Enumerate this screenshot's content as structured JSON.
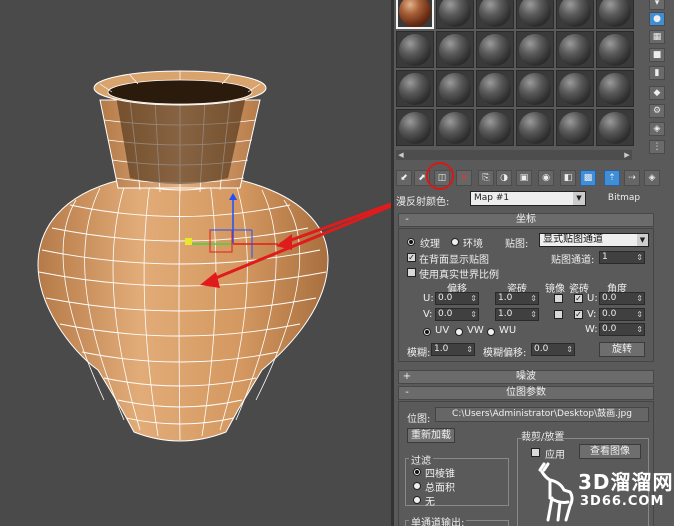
{
  "viewport": {
    "colors": {
      "background": "#4a4a4a",
      "vase": "#d59c66",
      "wire": "#ffffff",
      "arrow": "#e01b1b"
    }
  },
  "material_editor": {
    "toolbar_icons": [
      "get-material-icon",
      "put-to-scene-icon",
      "assign-material-icon",
      "reset-map-icon",
      "make-copy-icon",
      "make-unique-icon",
      "put-to-library-icon",
      "material-id-icon",
      "show-in-viewport-icon",
      "show-end-result-icon",
      "go-to-parent-icon",
      "go-forward-sibling-icon"
    ],
    "map_row": {
      "label": "漫反射颜色:",
      "map_name": "Map #1",
      "map_type": "Bitmap"
    },
    "coordinates": {
      "title": "坐标",
      "texture_label": "纹理",
      "environment_label": "环境",
      "mapping_label": "贴图:",
      "mapping_value": "显式贴图通道",
      "show_map_on_back": "在背面显示贴图",
      "map_channel_label": "贴图通道:",
      "map_channel_value": "1",
      "use_real_world": "使用真实世界比例",
      "offset_header": "偏移",
      "tiling_header": "瓷砖",
      "mirror_header": "镜像",
      "tile_header": "瓷砖",
      "angle_header": "角度",
      "u_label": "U:",
      "v_label": "V:",
      "w_label": "W:",
      "u_offset": "0.0",
      "v_offset": "0.0",
      "u_tiling": "1.0",
      "v_tiling": "1.0",
      "u_angle": "0.0",
      "v_angle": "0.0",
      "w_angle": "0.0",
      "uv_label": "UV",
      "vw_label": "VW",
      "wu_label": "WU",
      "blur_label": "模糊:",
      "blur_value": "1.0",
      "blur_offset_label": "模糊偏移:",
      "blur_offset_value": "0.0",
      "rotate_button": "旋转"
    },
    "noise": {
      "title": "噪波"
    },
    "bitmap_params": {
      "title": "位图参数",
      "bitmap_label": "位图:",
      "bitmap_path": "C:\\Users\\Administrator\\Desktop\\鼓画.jpg",
      "reload_button": "重新加载",
      "crop_group": "裁剪/放置",
      "apply_label": "应用",
      "view_image_button": "查看图像",
      "filter_group": "过滤",
      "filter_pyramidal": "四棱锥",
      "filter_summed": "总面积",
      "filter_none": "无",
      "mono_channel": "单通道输出:"
    }
  },
  "watermark": {
    "brand": "3D溜溜网",
    "url": "3D66.COM"
  }
}
